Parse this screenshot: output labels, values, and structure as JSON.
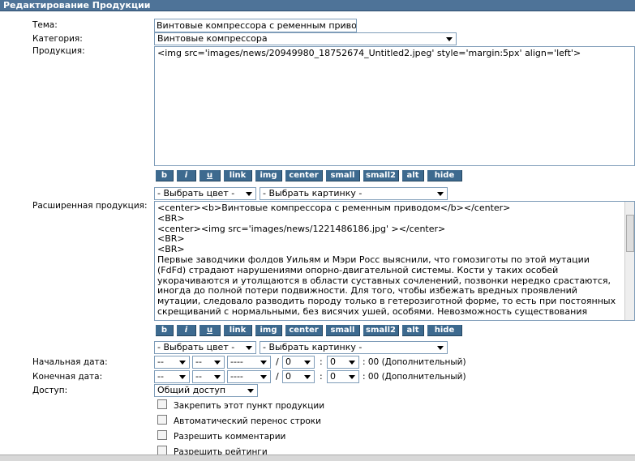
{
  "title": "Редактирование Продукции",
  "labels": {
    "theme": "Тема:",
    "category": "Категория:",
    "product": "Продукция:",
    "extended": "Расширенная продукция:",
    "start_date": "Начальная дата:",
    "end_date": "Конечная дата:",
    "access": "Доступ:"
  },
  "theme_value": "Винтовые компрессора с ременным приво",
  "category_value": "Винтовые компрессора",
  "product_text": "<img src='images/news/20949980_18752674_Untitled2.jpeg' style='margin:5px' align='left'>",
  "toolbar": [
    "b",
    "i",
    "u",
    "link",
    "img",
    "center",
    "small",
    "small2",
    "alt",
    "hide"
  ],
  "color_select": "- Выбрать цвет -",
  "image_select": "- Выбрать картинку -",
  "extended_lines": [
    "<center><b>Винтовые компрессора с ременным приводом</b></center>",
    "<BR>",
    "<center><img src='images/news/1221486186.jpg' ></center>",
    "<BR>",
    "<BR>",
    "Первые заводчики фолдов Уильям и Мэри Росс выяснили, что гомозиготы по этой мутации",
    "(FdFd) страдают нарушениями опорно-двигательной системы. Кости у таких особей",
    "укорачиваются и утолщаются в области суставных сочленений, позвонки нередко срастаются,",
    "иногда до полной потери подвижности. Для того, чтобы избежать вредных проявлений",
    "мутации, следовало разводить породу только в гетерозиготной форме, то есть при постоянных",
    "скрещиваний с нормальными, без висячих ушей, особями. Невозможность существования"
  ],
  "date": {
    "day": "--",
    "month": "--",
    "year": "----",
    "slash": "/",
    "hour": "0",
    "colon": ":",
    "minute": "0",
    "suffix": ": 00 (Дополнительный)"
  },
  "access_value": "Общий доступ",
  "options": [
    "Закрепить этот пункт продукции",
    "Автоматический перенос строки",
    "Разрешить комментарии",
    "Разрешить рейтинги"
  ]
}
